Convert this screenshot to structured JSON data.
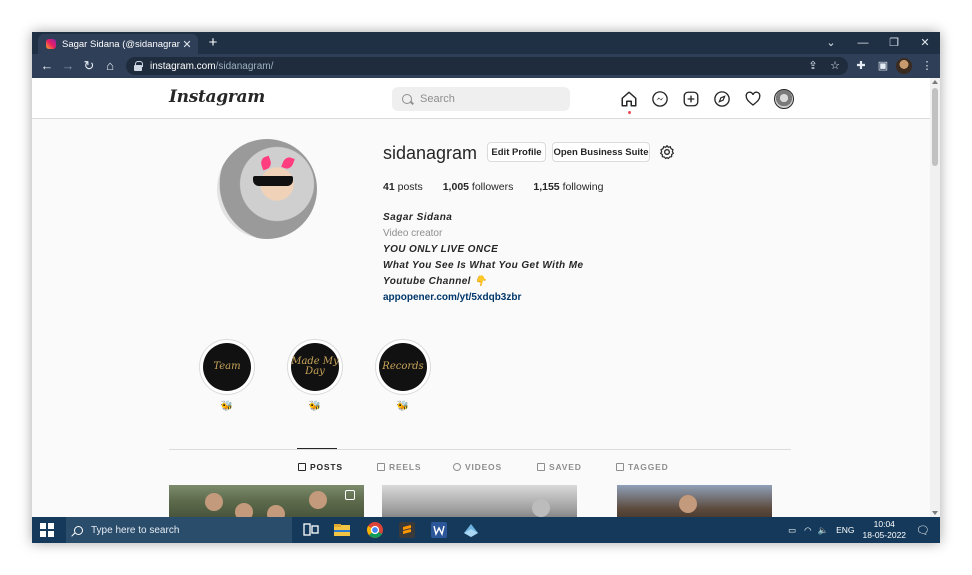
{
  "browser": {
    "tab_title": "Sagar Sidana (@sidanagram) • Instagram",
    "url_host": "instagram.com",
    "url_path": "/sidanagram/"
  },
  "instagram": {
    "logo": "Instagram",
    "search_placeholder": "Search"
  },
  "profile": {
    "username": "sidanagram",
    "edit_profile_label": "Edit Profile",
    "business_suite_label": "Open Business Suite",
    "stats": {
      "posts_count": "41",
      "posts_label": "posts",
      "followers_count": "1,005",
      "followers_label": "followers",
      "following_count": "1,155",
      "following_label": "following"
    },
    "bio": {
      "name": "Sagar Sidana",
      "category": "Video creator",
      "line1": "YOU ONLY LIVE ONCE",
      "line2": "What You See Is What You Get With Me",
      "line3": "Youtube Channel 👇",
      "link": "appopener.com/yt/5xdqb3zbr"
    }
  },
  "highlights": [
    {
      "cover_text": "Team",
      "caption": "🐝"
    },
    {
      "cover_text": "Made My Day",
      "caption": "🐝"
    },
    {
      "cover_text": "Records",
      "caption": "🐝"
    }
  ],
  "profile_tabs": [
    {
      "label": "POSTS",
      "icon": "grid-icon",
      "active": true
    },
    {
      "label": "REELS",
      "icon": "reels-icon",
      "active": false
    },
    {
      "label": "VIDEOS",
      "icon": "play-icon",
      "active": false
    },
    {
      "label": "SAVED",
      "icon": "bookmark-icon",
      "active": false
    },
    {
      "label": "TAGGED",
      "icon": "tag-icon",
      "active": false
    }
  ],
  "taskbar": {
    "search_placeholder": "Type here to search",
    "language": "ENG",
    "time": "10:04",
    "date": "18-05-2022"
  },
  "colors": {
    "browser_dark": "#1f2f44",
    "taskbar": "#14395a",
    "ig_link": "#00376b",
    "notification_dot": "#ed4956"
  }
}
